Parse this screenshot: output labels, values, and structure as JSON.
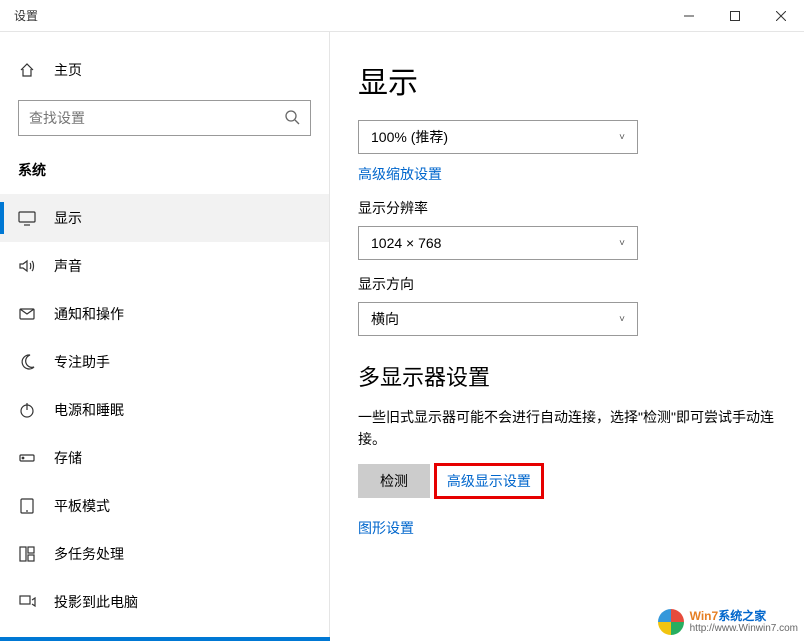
{
  "window": {
    "title": "设置"
  },
  "sidebar": {
    "home": "主页",
    "searchPlaceholder": "查找设置",
    "category": "系统",
    "items": [
      {
        "label": "显示",
        "icon": "monitor",
        "active": true
      },
      {
        "label": "声音",
        "icon": "speaker",
        "active": false
      },
      {
        "label": "通知和操作",
        "icon": "notification",
        "active": false
      },
      {
        "label": "专注助手",
        "icon": "moon",
        "active": false
      },
      {
        "label": "电源和睡眠",
        "icon": "power",
        "active": false
      },
      {
        "label": "存储",
        "icon": "storage",
        "active": false
      },
      {
        "label": "平板模式",
        "icon": "tablet",
        "active": false
      },
      {
        "label": "多任务处理",
        "icon": "multitask",
        "active": false
      },
      {
        "label": "投影到此电脑",
        "icon": "project",
        "active": false
      }
    ]
  },
  "main": {
    "title": "显示",
    "scaleValue": "100% (推荐)",
    "advancedScalingLink": "高级缩放设置",
    "resolutionLabel": "显示分辨率",
    "resolutionValue": "1024 × 768",
    "orientationLabel": "显示方向",
    "orientationValue": "横向",
    "multiMonitorTitle": "多显示器设置",
    "multiMonitorDesc": "一些旧式显示器可能不会进行自动连接，选择\"检测\"即可尝试手动连接。",
    "detectButton": "检测",
    "advancedDisplayLink": "高级显示设置",
    "graphicsLink": "图形设置"
  },
  "watermark": {
    "line1a": "Win7",
    "line1b": "系统之家",
    "line2": "http://www.Winwin7.com"
  }
}
